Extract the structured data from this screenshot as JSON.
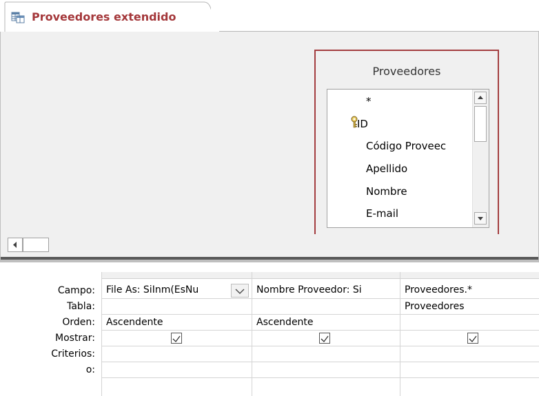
{
  "tab": {
    "label": "Proveedores extendido",
    "icon": "query-design-icon",
    "accent": "#a4373a"
  },
  "table": {
    "title": "Proveedores",
    "fields": [
      "*",
      "ID",
      "Código Proveec",
      "Apellido",
      "Nombre",
      "E-mail"
    ],
    "primary_key": "ID"
  },
  "grid": {
    "row_labels": [
      "Campo:",
      "Tabla:",
      "Orden:",
      "Mostrar:",
      "Criterios:",
      "o:"
    ],
    "columns": [
      {
        "campo": "File As: SiInm(EsNu",
        "tabla": "",
        "orden": "Ascendente",
        "mostrar": true
      },
      {
        "campo": "Nombre Proveedor: Si",
        "tabla": "",
        "orden": "Ascendente",
        "mostrar": true
      },
      {
        "campo": "Proveedores.*",
        "tabla": "Proveedores",
        "orden": "",
        "mostrar": true
      }
    ]
  }
}
